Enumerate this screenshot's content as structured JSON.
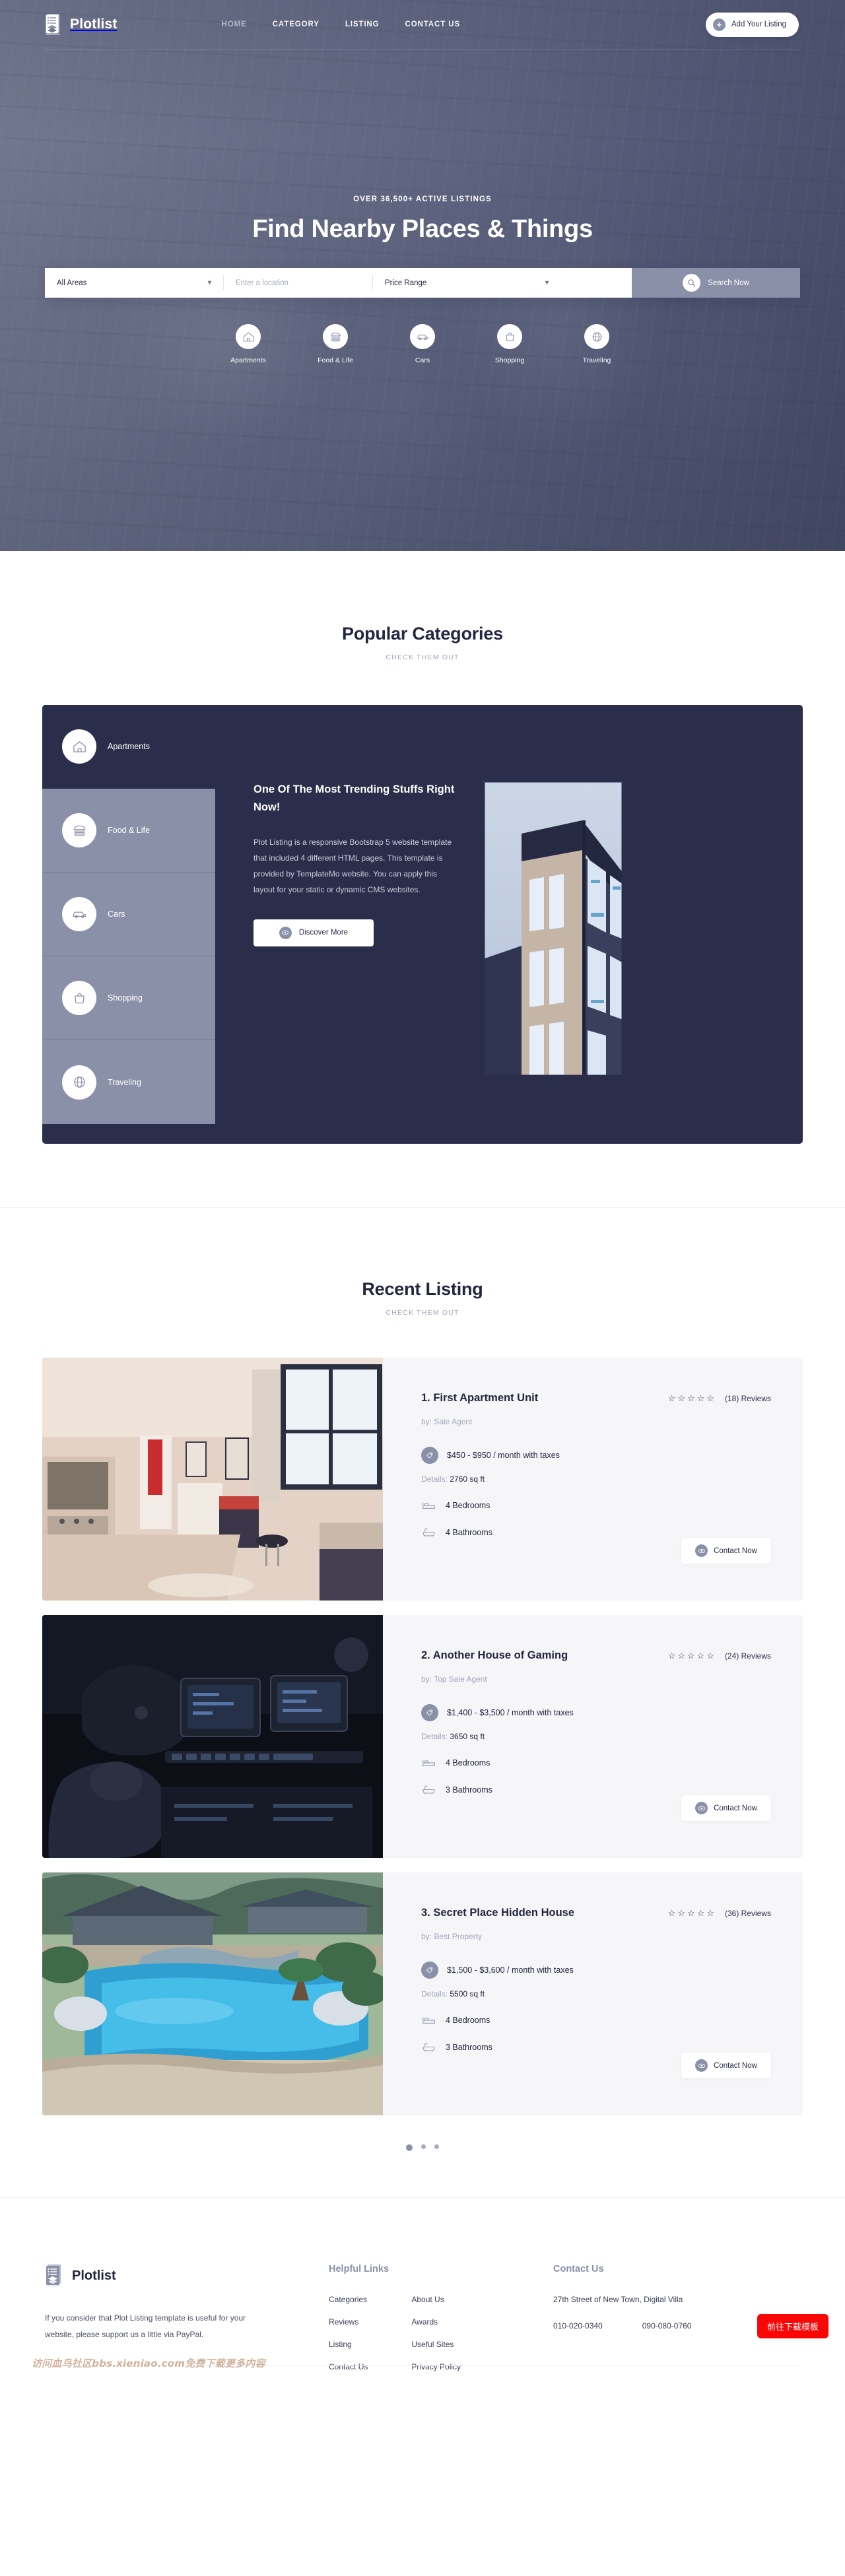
{
  "brand": {
    "name": "Plotlist",
    "logo_icon": "document-stack-icon"
  },
  "nav": {
    "items": [
      {
        "label": "HOME",
        "active": true
      },
      {
        "label": "CATEGORY",
        "active": false
      },
      {
        "label": "LISTING",
        "active": false
      },
      {
        "label": "CONTACT US",
        "active": false
      }
    ],
    "cta": {
      "label": "Add Your Listing",
      "icon": "plus-icon"
    }
  },
  "hero": {
    "eyebrow": "OVER 36,500+ ACTIVE LISTINGS",
    "title": "Find Nearby Places & Things",
    "search": {
      "area_value": "All Areas",
      "location_placeholder": "Enter a location",
      "price_value": "Price Range",
      "button_label": "Search Now",
      "search_icon": "magnifier-icon",
      "caret_icon": "chevron-down-icon"
    },
    "quick_categories": [
      {
        "label": "Apartments",
        "icon": "house-icon"
      },
      {
        "label": "Food & Life",
        "icon": "burger-icon"
      },
      {
        "label": "Cars",
        "icon": "car-icon"
      },
      {
        "label": "Shopping",
        "icon": "handbag-icon"
      },
      {
        "label": "Traveling",
        "icon": "globe-icon"
      }
    ]
  },
  "categories_section": {
    "title": "Popular Categories",
    "subtitle": "CHECK THEM OUT",
    "tabs": [
      {
        "label": "Apartments",
        "icon": "house-icon",
        "active": true
      },
      {
        "label": "Food & Life",
        "icon": "burger-icon",
        "active": false
      },
      {
        "label": "Cars",
        "icon": "car-icon",
        "active": false
      },
      {
        "label": "Shopping",
        "icon": "handbag-icon",
        "active": false
      },
      {
        "label": "Traveling",
        "icon": "globe-icon",
        "active": false
      }
    ],
    "panel": {
      "heading": "One Of The Most Trending Stuffs Right Now!",
      "body": "Plot Listing is a responsive Bootstrap 5 website template that included 4 different HTML pages. This template is provided by TemplateMo website. You can apply this layout for your static or dynamic CMS websites.",
      "button_label": "Discover More",
      "button_icon": "eye-icon",
      "image_alt": "modern-apartment-building-photo"
    }
  },
  "recent_section": {
    "title": "Recent Listing",
    "subtitle": "CHECK THEM OUT",
    "contact_button_label": "Contact Now",
    "contact_button_icon": "eye-icon",
    "details_label": "Details:",
    "star_glyph": "☆",
    "star_count": 5,
    "listings": [
      {
        "title": "1. First Apartment Unit",
        "reviews": "(18) Reviews",
        "author": "by: Sale Agent",
        "price": "$450 - $950 / month with taxes",
        "area": "2760 sq ft",
        "bedrooms": "4 Bedrooms",
        "bathrooms": "4 Bathrooms",
        "image_alt": "apartment-living-room-photo"
      },
      {
        "title": "2. Another House of Gaming",
        "reviews": "(24) Reviews",
        "author": "by: Top Sale Agent",
        "price": "$1,400 - $3,500 / month with taxes",
        "area": "3650 sq ft",
        "bedrooms": "4 Bedrooms",
        "bathrooms": "3 Bathrooms",
        "image_alt": "gaming-setup-dark-photo"
      },
      {
        "title": "3. Secret Place Hidden House",
        "reviews": "(36) Reviews",
        "author": "by: Best Property",
        "price": "$1,500 - $3,600 / month with taxes",
        "area": "5500 sq ft",
        "bedrooms": "4 Bedrooms",
        "bathrooms": "3 Bathrooms",
        "image_alt": "villa-pool-photo"
      }
    ],
    "pagination": {
      "total": 3,
      "active_index": 0
    }
  },
  "footer": {
    "brand_name": "Plotlist",
    "description": "If you consider that Plot Listing template is useful for your website, please support us a little via PayPal.",
    "helpful_links": {
      "heading": "Helpful Links",
      "column_one": [
        "Categories",
        "Reviews",
        "Listing",
        "Contact Us"
      ],
      "column_two": [
        "About Us",
        "Awards",
        "Useful Sites",
        "Privacy Policy"
      ]
    },
    "contact": {
      "heading": "Contact Us",
      "address": "27th Street of New Town, Digital Villa",
      "phone_one": "010-020-0340",
      "phone_two": "090-080-0760"
    }
  },
  "overlay": {
    "download_button": "前往下载模板",
    "watermark": "访问血鸟社区bbs.xieniao.com免费下载更多内容"
  },
  "colors": {
    "dark": "#2b2e4a",
    "muted": "#8a90a8",
    "accent_red": "#fb0606",
    "card_bg": "#f6f6f8"
  }
}
